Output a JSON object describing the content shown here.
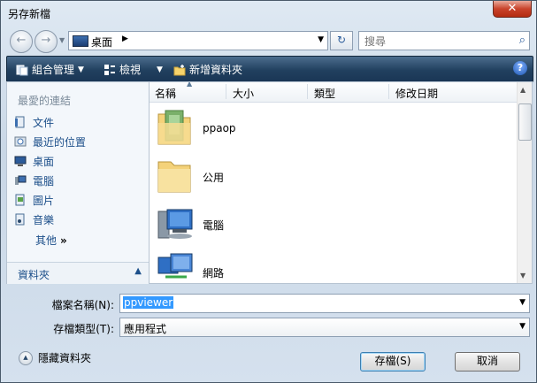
{
  "window": {
    "title": "另存新檔",
    "close_glyph": "✕"
  },
  "navigation": {
    "back_glyph": "←",
    "forward_glyph": "→",
    "address": {
      "location": "桌面",
      "separator": "▶"
    },
    "refresh_glyph": "↻",
    "search_placeholder": "搜尋"
  },
  "toolbar": {
    "organize_label": "組合管理",
    "views_label": "檢視",
    "new_folder_label": "新增資料夾",
    "help_glyph": "?"
  },
  "sidebar": {
    "header": "最愛的連結",
    "items": [
      {
        "label": "文件",
        "icon": "documents-icon"
      },
      {
        "label": "最近的位置",
        "icon": "recent-places-icon"
      },
      {
        "label": "桌面",
        "icon": "desktop-icon"
      },
      {
        "label": "電腦",
        "icon": "computer-icon"
      },
      {
        "label": "圖片",
        "icon": "pictures-icon"
      },
      {
        "label": "音樂",
        "icon": "music-icon"
      }
    ],
    "more_label": "其他",
    "more_glyph": "»",
    "folders_label": "資料夾",
    "folders_toggle_glyph": "▲"
  },
  "file_list": {
    "columns": [
      "名稱",
      "大小",
      "類型",
      "修改日期"
    ],
    "items": [
      {
        "name": "ppaop",
        "icon": "user-folder-icon"
      },
      {
        "name": "公用",
        "icon": "folder-icon"
      },
      {
        "name": "電腦",
        "icon": "computer-icon"
      },
      {
        "name": "網路",
        "icon": "network-icon"
      }
    ]
  },
  "form": {
    "filename_label": "檔案名稱(N):",
    "filename_value": "ppviewer",
    "filetype_label": "存檔類型(T):",
    "filetype_value": "應用程式"
  },
  "footer": {
    "hide_folders_label": "隱藏資料夾",
    "save_label": "存檔(S)",
    "cancel_label": "取消"
  },
  "colors": {
    "toolbar_bg": "#21405f",
    "link_text": "#1c4f8a",
    "selection": "#3399ff",
    "close_button": "#c9432b"
  }
}
